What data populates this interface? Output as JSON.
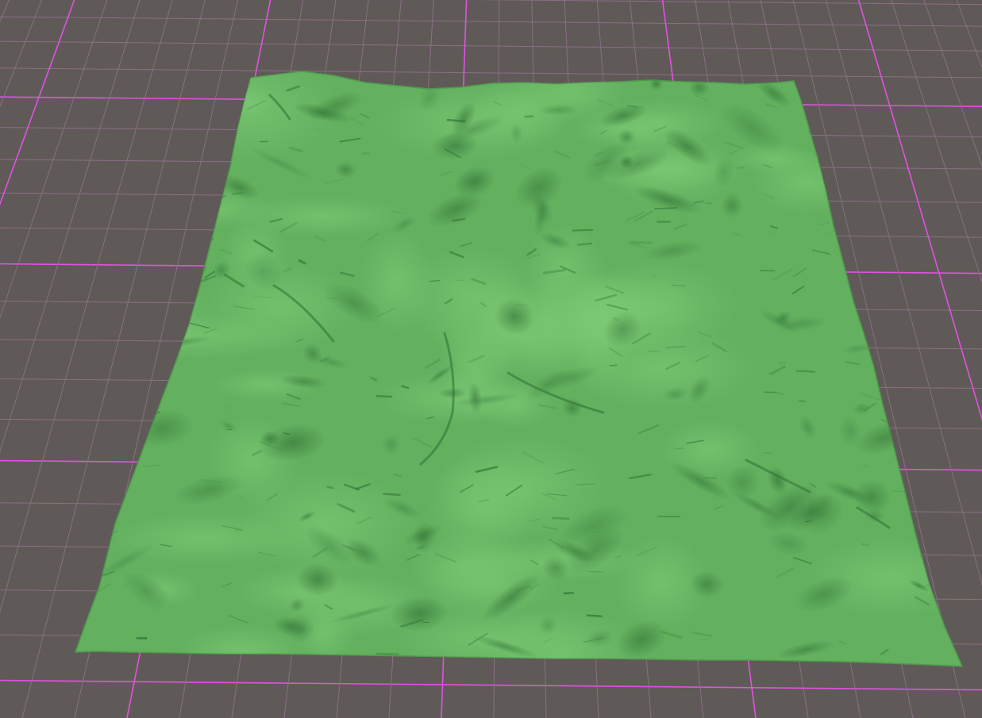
{
  "scene": {
    "background_color": "#5f5a57",
    "grid_minor_color": "#8a6f86",
    "grid_major_color": "#e052e0",
    "terrain_base_color": "#63b05f",
    "terrain_light_color": "#74c06d",
    "terrain_shadow_color": "#2f6f33",
    "objects": [
      "ground-grid",
      "terrain-mesh"
    ]
  }
}
